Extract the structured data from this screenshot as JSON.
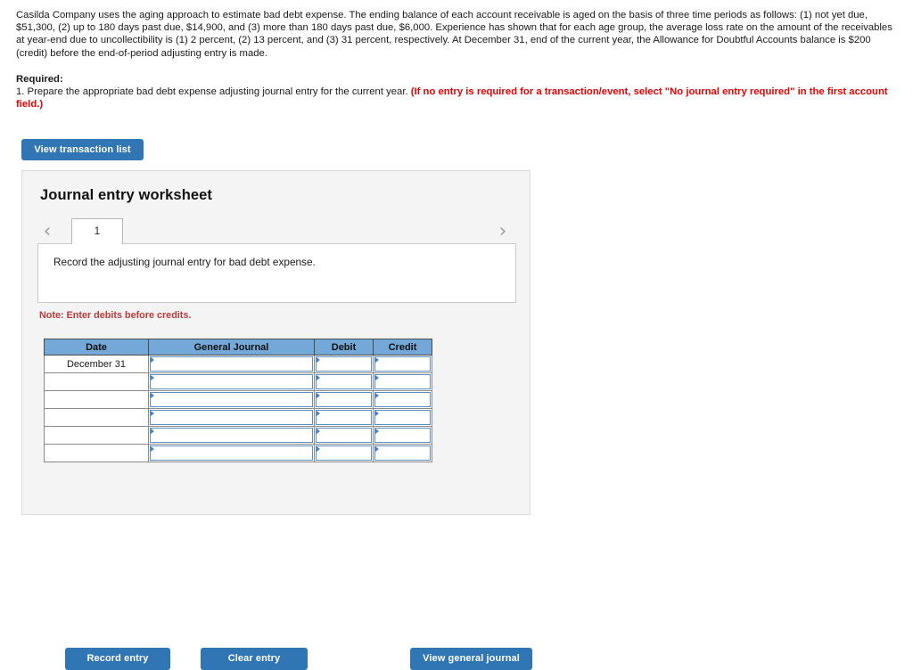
{
  "problem": {
    "statement": "Casilda Company uses the aging approach to estimate bad debt expense. The ending balance of each account receivable is aged on the basis of three time periods as follows: (1) not yet due, $51,300, (2) up to 180 days past due, $14,900, and (3) more than 180 days past due, $6,000. Experience has shown that for each age group, the average loss rate on the amount of the receivables at year-end due to uncollectibility is (1) 2 percent, (2) 13 percent, and (3) 31 percent, respectively. At December 31, end of the current year, the Allowance for Doubtful Accounts balance is $200 (credit) before the end-of-period adjusting entry is made."
  },
  "required": {
    "label": "Required:",
    "item_text": "1. Prepare the appropriate bad debt expense adjusting journal entry for the current year. ",
    "item_note": "(If no entry is required for a transaction/event, select \"No journal entry required\" in the first account field.)"
  },
  "toolbar": {
    "view_transaction_list_label": "View transaction list"
  },
  "worksheet": {
    "title": "Journal entry worksheet",
    "tabs": [
      {
        "label": "1"
      }
    ],
    "prev_icon": "‹",
    "next_icon": "›",
    "instruction": "Record the adjusting journal entry for bad debt expense.",
    "note": "Note: Enter debits before credits."
  },
  "journal_table": {
    "headers": [
      "Date",
      "General Journal",
      "Debit",
      "Credit"
    ],
    "rows": [
      {
        "date": "December 31",
        "general_journal": "",
        "debit": "",
        "credit": ""
      },
      {
        "date": "",
        "general_journal": "",
        "debit": "",
        "credit": ""
      },
      {
        "date": "",
        "general_journal": "",
        "debit": "",
        "credit": ""
      },
      {
        "date": "",
        "general_journal": "",
        "debit": "",
        "credit": ""
      },
      {
        "date": "",
        "general_journal": "",
        "debit": "",
        "credit": ""
      },
      {
        "date": "",
        "general_journal": "",
        "debit": "",
        "credit": ""
      }
    ]
  },
  "footer": {
    "record_entry_label": "Record entry",
    "clear_entry_label": "Clear entry",
    "view_general_journal_label": "View general journal"
  },
  "colors": {
    "button_blue": "#3076b5",
    "table_header_blue": "#74a8d8",
    "note_red": "#bd3a3a",
    "required_red": "#ee0000",
    "panel_gray": "#f4f4f4"
  }
}
